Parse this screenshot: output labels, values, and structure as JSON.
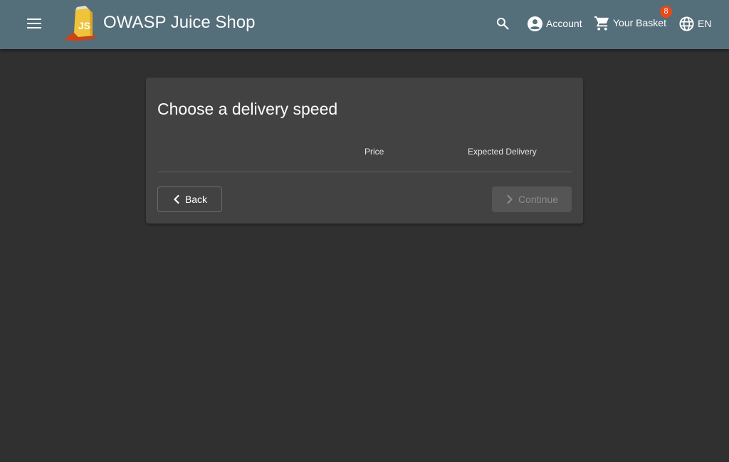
{
  "header": {
    "title": "OWASP Juice Shop",
    "account_label": "Account",
    "basket_label": "Your Basket",
    "basket_count": "8",
    "language_label": "EN",
    "icons": [
      "menu-icon",
      "juice-shop-logo",
      "search-icon",
      "account-circle-icon",
      "cart-icon",
      "globe-icon"
    ]
  },
  "delivery": {
    "title": "Choose a delivery speed",
    "columns": [
      "Price",
      "Expected Delivery"
    ],
    "back_label": "Back",
    "continue_label": "Continue",
    "continue_disabled": true
  },
  "colors": {
    "toolbar": "#546e7a",
    "background": "#303030",
    "card": "#424242",
    "badge": "#e64a19"
  }
}
